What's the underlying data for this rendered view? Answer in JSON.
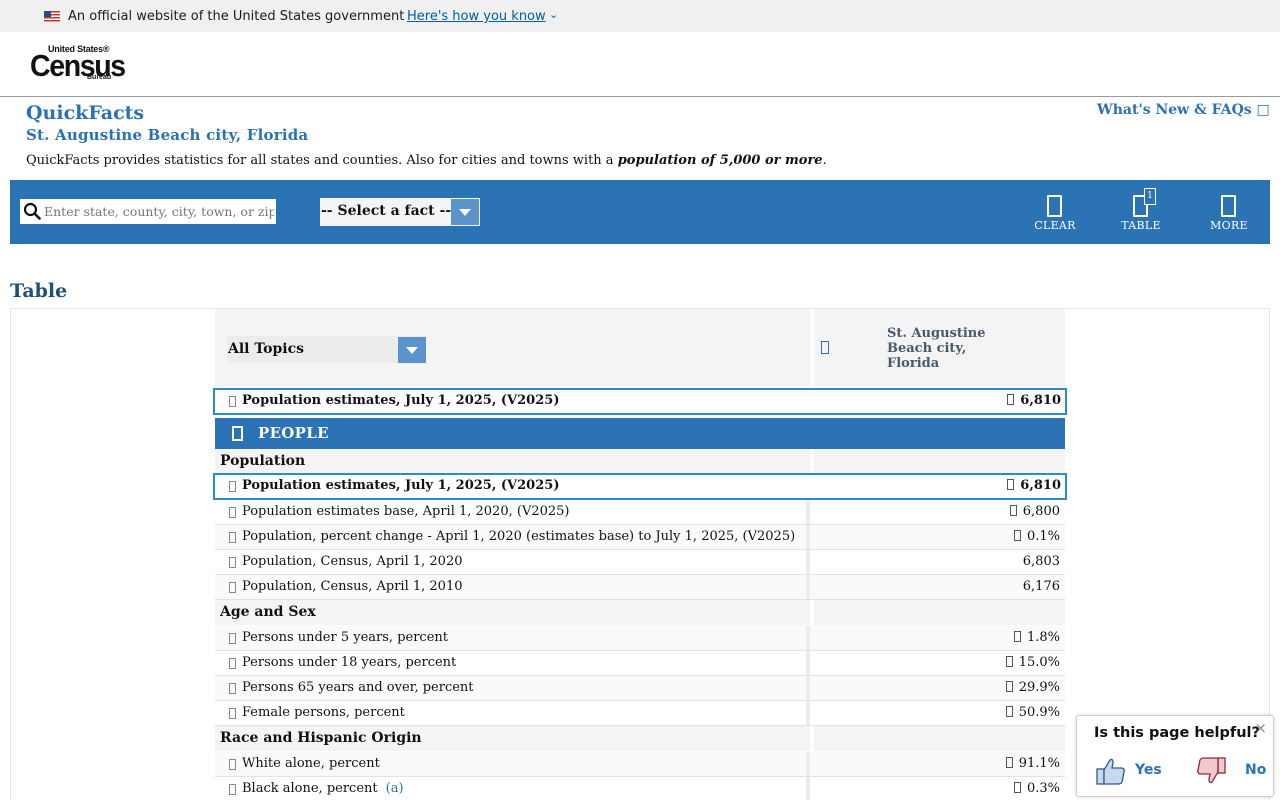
{
  "gov_banner": {
    "text": "An official website of the United States government",
    "link": "Here's how you know"
  },
  "logo": {
    "line1": "United States®",
    "line2": "Census",
    "line3": "Bureau"
  },
  "header": {
    "title": "QuickFacts",
    "place": "St. Augustine Beach city, Florida",
    "whats_new": "What's New & FAQs □",
    "desc_prefix": "QuickFacts provides statistics for all states and counties. Also for cities and towns with a ",
    "desc_bold": "population of 5,000 or more",
    "desc_suffix": "."
  },
  "toolbar": {
    "search_placeholder": "Enter state, county, city, town, or zip code",
    "fact_select": "-- Select a fact --",
    "clear": "CLEAR",
    "table": "TABLE",
    "table_badge": "1",
    "more": "MORE"
  },
  "table": {
    "heading": "Table",
    "topics": "All Topics",
    "place_header": "St. Augustine Beach city, Florida",
    "top_row": {
      "label": "Population estimates, July 1, 2025, (V2025)",
      "value": "6,810"
    },
    "section": "PEOPLE",
    "groups": [
      {
        "title": "Population",
        "rows": [
          {
            "label": "Population estimates, July 1, 2025, (V2025)",
            "value": "6,810",
            "highlight": true
          },
          {
            "label": "Population estimates base, April 1, 2020, (V2025)",
            "value": "6,800"
          },
          {
            "label": "Population, percent change - April 1, 2020 (estimates base) to July 1, 2025, (V2025)",
            "value": "0.1%"
          },
          {
            "label": "Population, Census, April 1, 2020",
            "value": "6,803"
          },
          {
            "label": "Population, Census, April 1, 2010",
            "value": "6,176"
          }
        ]
      },
      {
        "title": "Age and Sex",
        "rows": [
          {
            "label": "Persons under 5 years, percent",
            "value": "1.8%"
          },
          {
            "label": "Persons under 18 years, percent",
            "value": "15.0%"
          },
          {
            "label": "Persons 65 years and over, percent",
            "value": "29.9%"
          },
          {
            "label": "Female persons, percent",
            "value": "50.9%"
          }
        ]
      },
      {
        "title": "Race and Hispanic Origin",
        "rows": [
          {
            "label": "White alone, percent",
            "value": "91.1%"
          },
          {
            "label": "Black alone, percent",
            "value": "0.3%",
            "note": "(a)"
          }
        ]
      }
    ]
  },
  "feedback": {
    "question": "Is this page helpful?",
    "yes": "Yes",
    "no": "No",
    "close": "×"
  }
}
